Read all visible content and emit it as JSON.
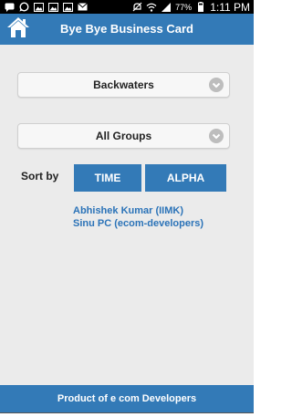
{
  "status_bar": {
    "left_icons": [
      "messages-icon",
      "whatsapp-icon",
      "photo-icon",
      "photo-icon",
      "photo-icon",
      "email-icon"
    ],
    "right_icons": [
      "mute-icon",
      "wifi-icon",
      "signal-icon"
    ],
    "battery": "77%",
    "time": "1:11 PM"
  },
  "app_bar": {
    "title": "Bye Bye Business Card",
    "home_icon": "home-icon"
  },
  "filters": {
    "location": "Backwaters",
    "group": "All Groups"
  },
  "sort": {
    "label": "Sort by",
    "time_label": "TIME",
    "alpha_label": "ALPHA"
  },
  "contacts": [
    "Abhishek Kumar (IIMK)",
    "Sinu PC (ecom-developers)"
  ],
  "footer": {
    "text": "Product of e com Developers"
  },
  "colors": {
    "primary": "#337ab7",
    "link": "#2b73b8",
    "background": "#ebebeb"
  }
}
